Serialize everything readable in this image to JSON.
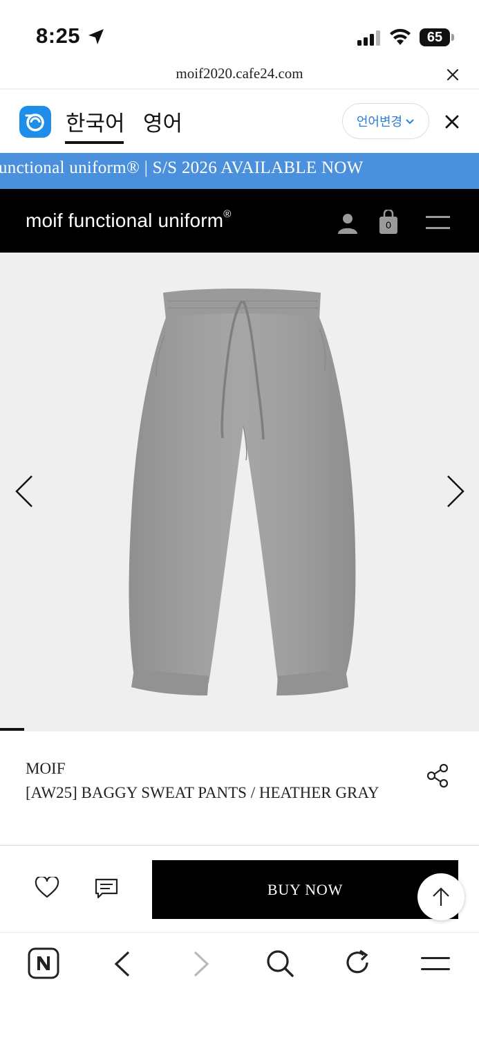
{
  "status_bar": {
    "time": "8:25",
    "battery": "65"
  },
  "url_bar": {
    "url": "moif2020.cafe24.com"
  },
  "translate_bar": {
    "tab_korean": "한국어",
    "tab_english": "영어",
    "change_language": "언어변경"
  },
  "banner": {
    "text": "unctional uniform®  |  S/S 2026 AVAILABLE NOW"
  },
  "header": {
    "logo": "moif functional uniform",
    "logo_mark": "®",
    "cart_count": "0"
  },
  "product": {
    "brand": "MOIF",
    "name": "[AW25] BAGGY SWEAT PANTS / HEATHER GRAY"
  },
  "actions": {
    "buy_now": "BUY NOW"
  },
  "colors": {
    "banner_blue": "#4a90dc",
    "translate_blue": "#1e8ee9",
    "header_black": "#000000",
    "image_bg": "#efefef"
  },
  "icons": [
    "location-arrow-icon",
    "signal-icon",
    "wifi-icon",
    "close-icon",
    "translate-logo-icon",
    "chevron-down-icon",
    "user-icon",
    "shopping-bag-icon",
    "menu-icon",
    "chevron-left-icon",
    "chevron-right-icon",
    "share-icon",
    "heart-icon",
    "review-icon",
    "arrow-up-icon",
    "naver-home-icon",
    "back-icon",
    "forward-icon",
    "search-icon",
    "reload-icon"
  ]
}
